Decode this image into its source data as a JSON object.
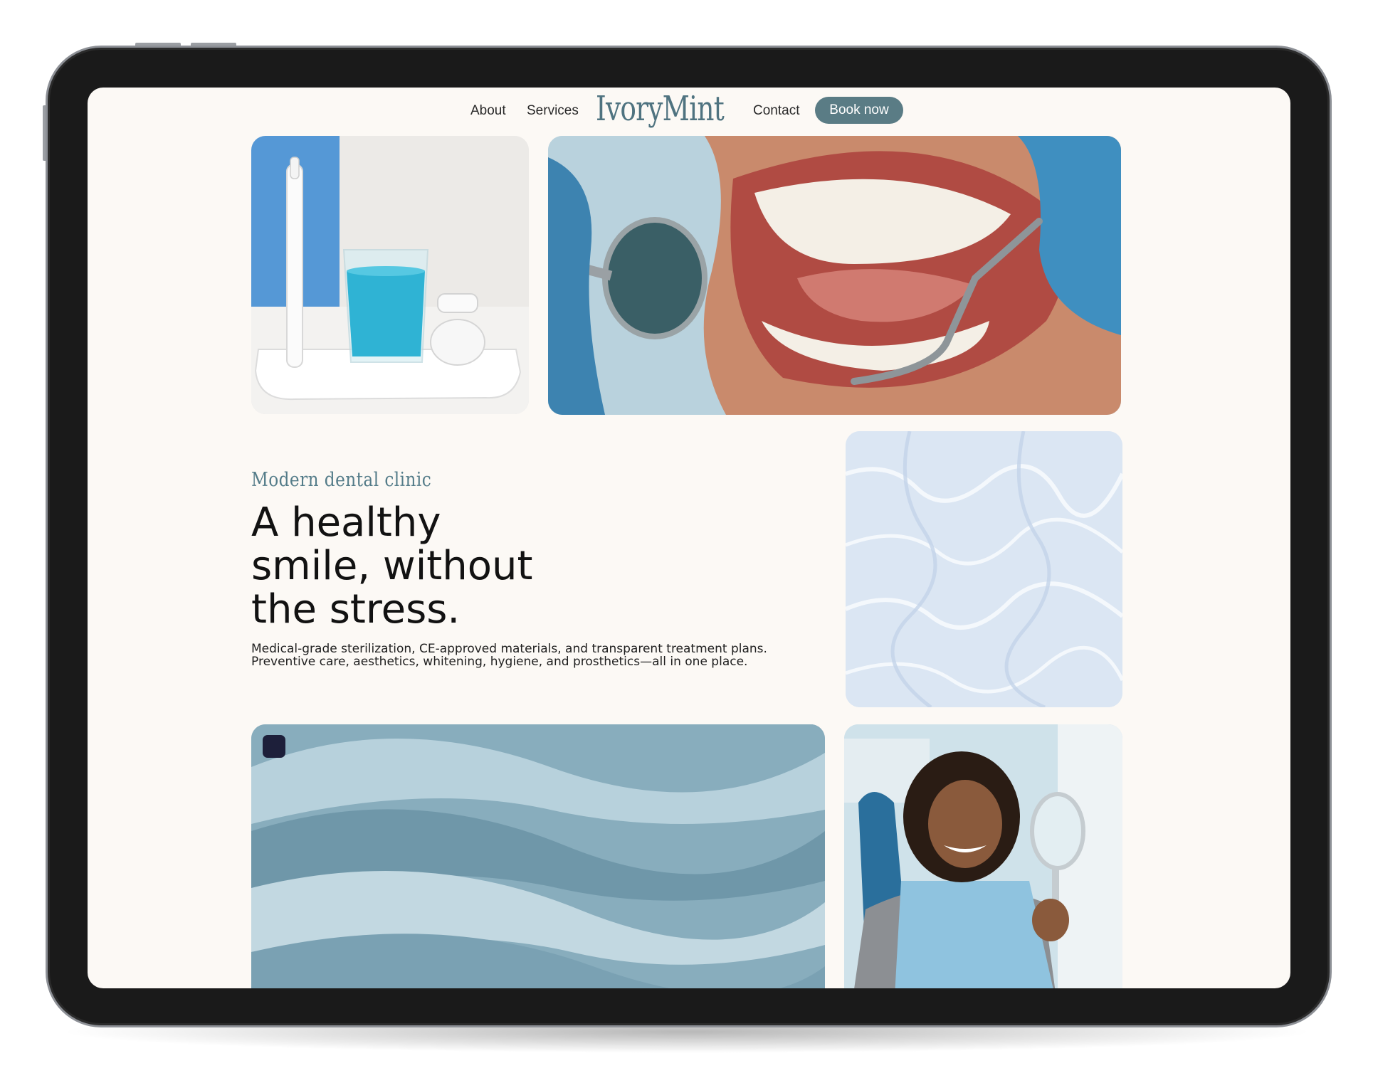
{
  "nav": {
    "about": "About",
    "services": "Services",
    "logo": "IvoryMint",
    "contact": "Contact",
    "book_now": "Book now"
  },
  "hero": {
    "eyebrow": "Modern dental clinic",
    "headline_lines": [
      "A healthy",
      "smile, without",
      "the stress."
    ],
    "body_lines": [
      "Medical-grade sterilization, CE-approved materials, and transparent treatment plans.",
      "Preventive care, aesthetics, whitening, hygiene, and prosthetics—all in one place."
    ]
  },
  "colors": {
    "page_background": "#fcf9f5",
    "accent": "#5a7c85",
    "logo": "#4f7380",
    "device_bezel": "#1a1a1a"
  },
  "icons": [
    "chip-icon"
  ]
}
